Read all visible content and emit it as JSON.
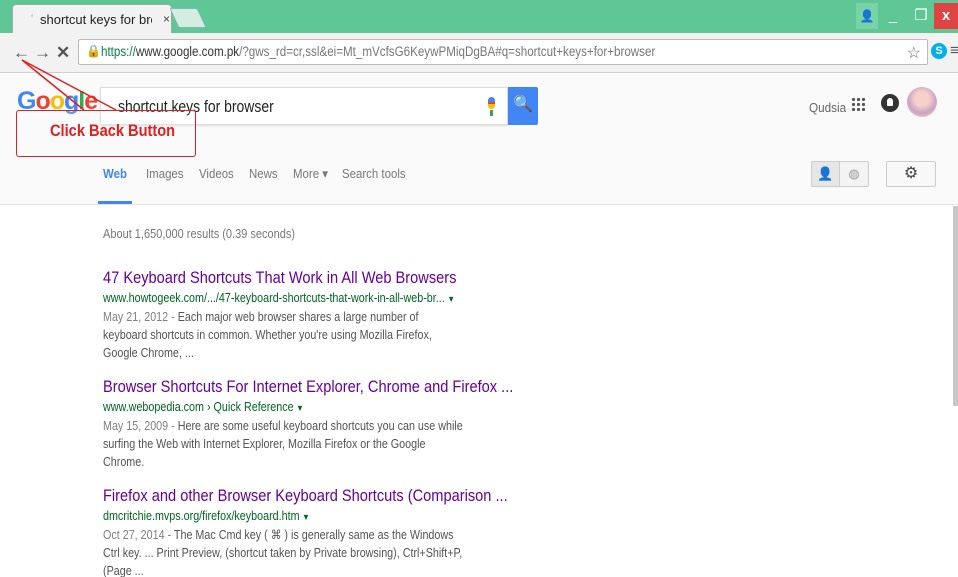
{
  "browser": {
    "tab_title": "shortcut keys for bro",
    "tab_close": "×",
    "url_scheme": "https://",
    "url_host": "www.google.com.pk",
    "url_rest": "/?gws_rd=cr,ssl&ei=Mt_mVcfsG6KeywPMiqDgBA#q=shortcut+keys+for+browser",
    "window_buttons": {
      "user": "👤",
      "minimize": "_",
      "maximize": "❐",
      "close": "x"
    },
    "nav": {
      "back": "←",
      "forward": "→",
      "stop": "✕"
    },
    "icons": {
      "star": "☆",
      "skype": "S",
      "menu": "≡",
      "lock": "🔒"
    }
  },
  "google": {
    "logo": [
      "G",
      "o",
      "o",
      "g",
      "l",
      "e"
    ],
    "query": "shortcut keys for browser",
    "search_button_icon": "🔍",
    "user_name": "Qudsia",
    "tabs": [
      {
        "label": "Web",
        "active": true
      },
      {
        "label": "Images",
        "active": false
      },
      {
        "label": "Videos",
        "active": false
      },
      {
        "label": "News",
        "active": false
      },
      {
        "label": "More ▾",
        "active": false
      },
      {
        "label": "Search tools",
        "active": false
      }
    ],
    "toggle_person_icon": "👤",
    "toggle_globe_icon": "◍",
    "settings_icon": "⚙"
  },
  "annotation": {
    "text": "Click Back Button",
    "color": "#e02020"
  },
  "results": {
    "stats": "About 1,650,000 results (0.39 seconds)",
    "items": [
      {
        "title": "47 Keyboard Shortcuts That Work in All Web Browsers",
        "url": "www.howtogeek.com/.../47-keyboard-shortcuts-that-work-in-all-web-br...",
        "date": "May 21, 2012 - ",
        "snippet": "Each major web browser shares a large number of keyboard shortcuts in common. Whether you're using Mozilla Firefox, Google Chrome, ..."
      },
      {
        "title": "Browser Shortcuts For Internet Explorer, Chrome and Firefox ...",
        "url": "www.webopedia.com › Quick Reference",
        "date": "May 15, 2009 - ",
        "snippet": "Here are some useful keyboard shortcuts you can use while surfing the Web with Internet Explorer, Mozilla Firefox or the Google Chrome."
      },
      {
        "title": "Firefox and other Browser Keyboard Shortcuts (Comparison ...",
        "url": "dmcritchie.mvps.org/firefox/keyboard.htm",
        "date": "Oct 27, 2014 - ",
        "snippet": "The Mac Cmd key ( ⌘ ) is generally same as the Windows Ctrl key. ... Print Preview, (shortcut taken by Private browsing), Ctrl+Shift+P, (Page ..."
      }
    ]
  },
  "colors": {
    "titlebar": "#5fc795",
    "link_visited": "#660099",
    "url_green": "#006621",
    "google_blue": "#4285f4"
  }
}
